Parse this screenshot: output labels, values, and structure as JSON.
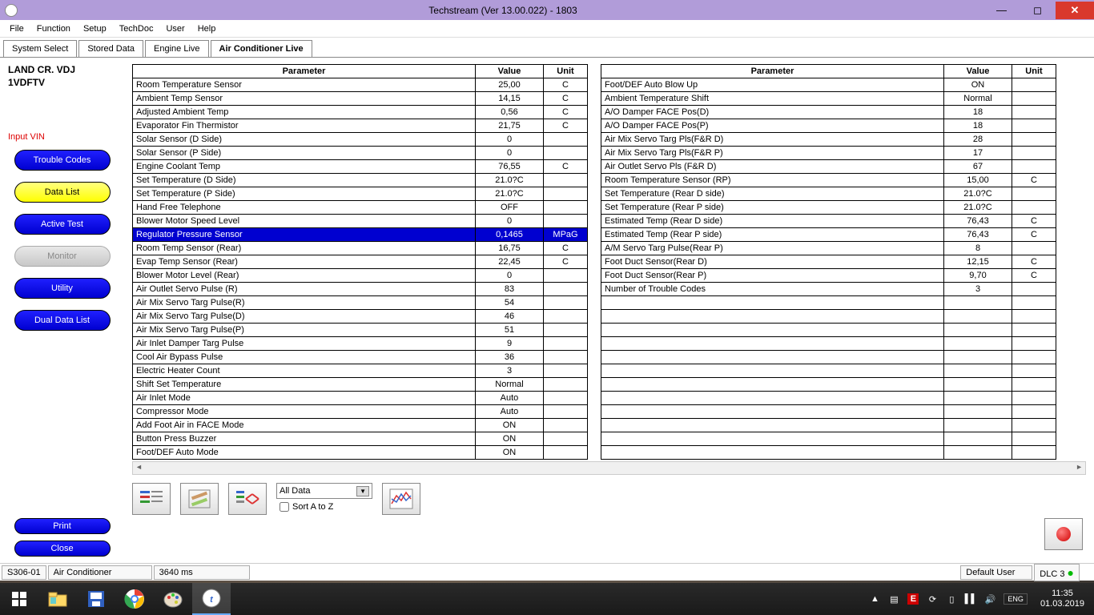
{
  "window": {
    "title": "Techstream (Ver 13.00.022) - 1803"
  },
  "menus": [
    "File",
    "Function",
    "Setup",
    "TechDoc",
    "User",
    "Help"
  ],
  "tabs": [
    "System Select",
    "Stored Data",
    "Engine Live",
    "Air Conditioner Live"
  ],
  "active_tab": 3,
  "vehicle": {
    "line1": "LAND CR. VDJ",
    "line2": "1VDFTV",
    "input_vin": "Input VIN"
  },
  "side_buttons": {
    "trouble": "Trouble Codes",
    "datalist": "Data List",
    "active": "Active Test",
    "monitor": "Monitor",
    "utility": "Utility",
    "dual": "Dual Data List",
    "print": "Print",
    "close": "Close"
  },
  "table_headers": {
    "param": "Parameter",
    "value": "Value",
    "unit": "Unit"
  },
  "selected_row_index": 12,
  "left_rows": [
    {
      "p": "Room Temperature Sensor",
      "v": "25,00",
      "u": "C"
    },
    {
      "p": "Ambient Temp Sensor",
      "v": "14,15",
      "u": "C"
    },
    {
      "p": "Adjusted Ambient Temp",
      "v": "0,56",
      "u": "C"
    },
    {
      "p": "Evaporator Fin Thermistor",
      "v": "21,75",
      "u": "C"
    },
    {
      "p": "Solar Sensor (D Side)",
      "v": "0",
      "u": ""
    },
    {
      "p": "Solar Sensor (P Side)",
      "v": "0",
      "u": ""
    },
    {
      "p": "Engine Coolant Temp",
      "v": "76,55",
      "u": "C"
    },
    {
      "p": "Set Temperature (D Side)",
      "v": "21.0?C",
      "u": ""
    },
    {
      "p": "Set Temperature (P Side)",
      "v": "21.0?C",
      "u": ""
    },
    {
      "p": "Hand Free Telephone",
      "v": "OFF",
      "u": ""
    },
    {
      "p": "Blower Motor Speed Level",
      "v": "0",
      "u": ""
    },
    {
      "p": "Regulator Pressure Sensor",
      "v": "0,1465",
      "u": "MPaG"
    },
    {
      "p": "Room Temp Sensor (Rear)",
      "v": "16,75",
      "u": "C"
    },
    {
      "p": "Evap Temp Sensor (Rear)",
      "v": "22,45",
      "u": "C"
    },
    {
      "p": "Blower Motor Level (Rear)",
      "v": "0",
      "u": ""
    },
    {
      "p": "Air Outlet Servo Pulse (R)",
      "v": "83",
      "u": ""
    },
    {
      "p": "Air Mix Servo Targ Pulse(R)",
      "v": "54",
      "u": ""
    },
    {
      "p": "Air Mix Servo Targ Pulse(D)",
      "v": "46",
      "u": ""
    },
    {
      "p": "Air Mix Servo Targ Pulse(P)",
      "v": "51",
      "u": ""
    },
    {
      "p": "Air Inlet Damper Targ Pulse",
      "v": "9",
      "u": ""
    },
    {
      "p": "Cool Air Bypass Pulse",
      "v": "36",
      "u": ""
    },
    {
      "p": "Electric Heater Count",
      "v": "3",
      "u": ""
    },
    {
      "p": "Shift Set Temperature",
      "v": "Normal",
      "u": ""
    },
    {
      "p": "Air Inlet Mode",
      "v": "Auto",
      "u": ""
    },
    {
      "p": "Compressor Mode",
      "v": "Auto",
      "u": ""
    },
    {
      "p": "Add Foot Air in FACE Mode",
      "v": "ON",
      "u": ""
    },
    {
      "p": "Button Press Buzzer",
      "v": "ON",
      "u": ""
    },
    {
      "p": "Foot/DEF Auto Mode",
      "v": "ON",
      "u": ""
    }
  ],
  "right_rows": [
    {
      "p": "Foot/DEF Auto Blow Up",
      "v": "ON",
      "u": ""
    },
    {
      "p": "Ambient Temperature Shift",
      "v": "Normal",
      "u": ""
    },
    {
      "p": "A/O Damper FACE Pos(D)",
      "v": "18",
      "u": ""
    },
    {
      "p": "A/O Damper FACE Pos(P)",
      "v": "18",
      "u": ""
    },
    {
      "p": "Air Mix Servo Targ Pls(F&R D)",
      "v": "28",
      "u": ""
    },
    {
      "p": "Air Mix Servo Targ Pls(F&R P)",
      "v": "17",
      "u": ""
    },
    {
      "p": "Air Outlet Servo Pls (F&R D)",
      "v": "67",
      "u": ""
    },
    {
      "p": "Room Temperature Sensor (RP)",
      "v": "15,00",
      "u": "C"
    },
    {
      "p": "Set Temperature (Rear D side)",
      "v": "21.0?C",
      "u": ""
    },
    {
      "p": "Set Temperature (Rear P side)",
      "v": "21.0?C",
      "u": ""
    },
    {
      "p": "Estimated Temp (Rear D side)",
      "v": "76,43",
      "u": "C"
    },
    {
      "p": "Estimated Temp (Rear P side)",
      "v": "76,43",
      "u": "C"
    },
    {
      "p": "A/M Servo Targ Pulse(Rear P)",
      "v": "8",
      "u": ""
    },
    {
      "p": "Foot Duct Sensor(Rear D)",
      "v": "12,15",
      "u": "C"
    },
    {
      "p": "Foot Duct Sensor(Rear P)",
      "v": "9,70",
      "u": "C"
    },
    {
      "p": "Number of Trouble Codes",
      "v": "3",
      "u": ""
    }
  ],
  "filter": {
    "value": "All Data",
    "sort": "Sort A to Z"
  },
  "status": {
    "code": "S306-01",
    "system": "Air Conditioner",
    "ms": "3640 ms",
    "user": "Default User",
    "dlc": "DLC 3"
  },
  "taskbar": {
    "lang": "ENG",
    "time": "11:35",
    "date": "01.03.2019"
  }
}
